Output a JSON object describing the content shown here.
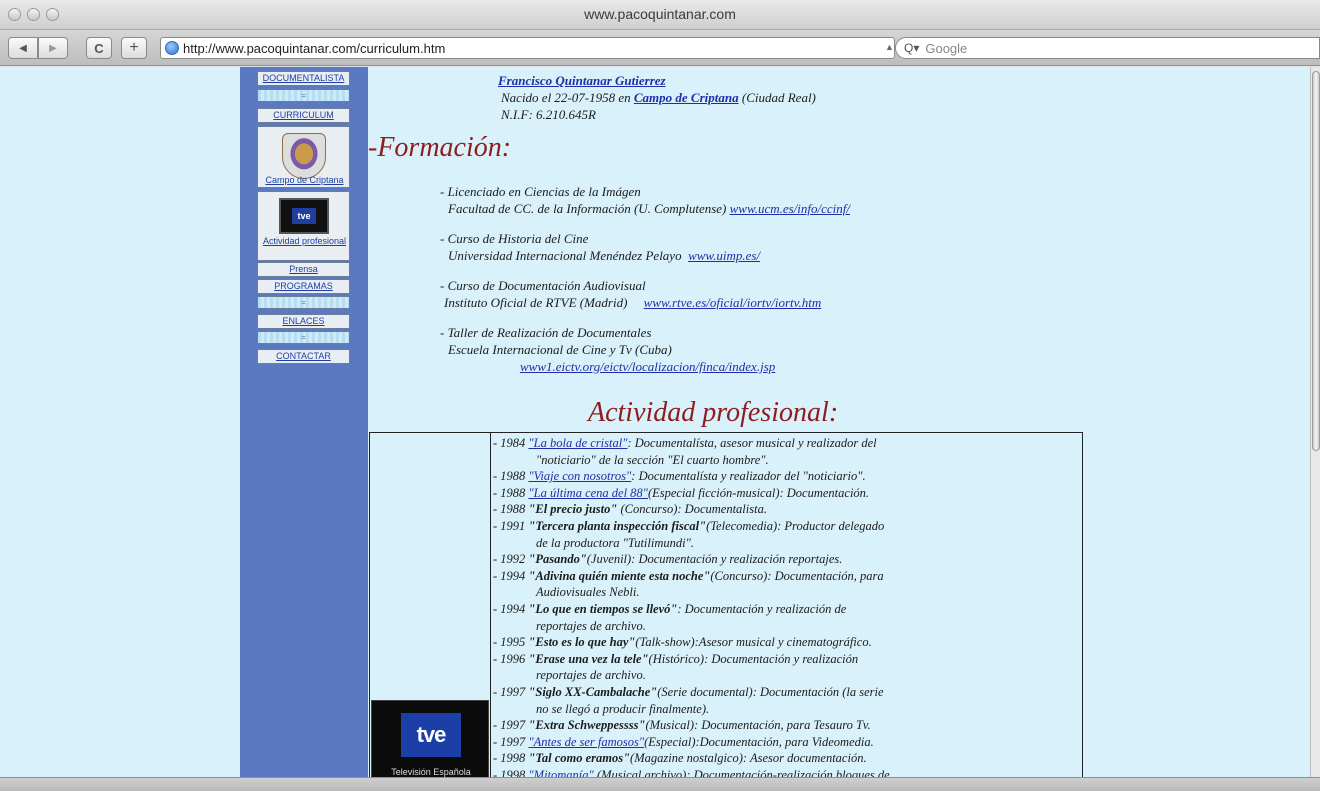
{
  "window": {
    "title": "www.pacoquintanar.com"
  },
  "toolbar": {
    "back": "◀",
    "forward": "▶",
    "reload": "C",
    "add": "+",
    "url": "http://www.pacoquintanar.com/curriculum.htm",
    "search_placeholder": "Google"
  },
  "nav": {
    "documentalista": "DOCUMENTALISTA",
    "sep": "=",
    "curriculum": "CURRICULUM",
    "campo": "Campo de Criptana",
    "tve_small": "tve",
    "actividad": "Actividad profesional",
    "prensa": "Prensa",
    "programas": "PROGRAMAS",
    "enlaces": "ENLACES",
    "contactar": "CONTACTAR"
  },
  "header": {
    "name": "Francisco Quintanar Gutierrez",
    "born_prefix": "Nacido el 22-07-1958 en ",
    "born_place": "Campo de Criptana",
    "born_suffix": " (Ciudad Real)",
    "nif": "N.I.F: 6.210.645R"
  },
  "formacion": {
    "heading": "-Formación:",
    "items": [
      {
        "line1": "- Licenciado en Ciencias de la Imágen",
        "line2": "Facultad de CC. de la Información (U. Complutense) ",
        "link": "www.ucm.es/info/ccinf/"
      },
      {
        "line1": "- Curso de Historia del Cine",
        "line2": "Universidad Internacional Menéndez Pelayo ",
        "link": "www.uimp.es/"
      },
      {
        "line1": "- Curso de Documentación Audiovisual",
        "line2": "Instituto Oficial de RTVE (Madrid) ",
        "link": "www.rtve.es/oficial/iortv/iortv.htm"
      },
      {
        "line1": "- Taller de Realización de Documentales",
        "line2": "Escuela Internacional de Cine y Tv (Cuba)",
        "link": "www1.eictv.org/eictv/localizacion/finca/index.jsp"
      }
    ]
  },
  "actividad": {
    "heading": "Actividad profesional:",
    "tve_logo": "tve",
    "tve_caption": "Televisión Española",
    "entries": [
      {
        "pre": "- 1984 ",
        "title": "\"La bola de cristal\"",
        "linked": true,
        "desc": ": Documentalísta, asesor musical y realizador del",
        "cont": "\"noticiario\" de la sección \"El cuarto hombre\"."
      },
      {
        "pre": "- 1988 ",
        "title": "\"Viaje con nosotros\"",
        "linked": true,
        "desc": ": Documentalísta y realizador del \"noticiario\".",
        "cont": ""
      },
      {
        "pre": "- 1988 ",
        "title": "\"La última cena del 88\"",
        "linked": true,
        "desc": "(Especial ficción-musical): Documentación.",
        "cont": ""
      },
      {
        "pre": "- 1988 ",
        "title": "\"El precio justo\"",
        "linked": false,
        "desc": " (Concurso): Documentalista.",
        "cont": ""
      },
      {
        "pre": "- 1991 ",
        "title": "\"Tercera planta inspección fiscal\"",
        "linked": false,
        "desc": "(Telecomedia): Productor delegado",
        "cont": "de la productora \"Tutilimundi\"."
      },
      {
        "pre": "- 1992 ",
        "title": "\"Pasando\"",
        "linked": false,
        "desc": "(Juvenil): Documentación y realización reportajes.",
        "cont": ""
      },
      {
        "pre": "- 1994 ",
        "title": "\"Adivina quién miente esta noche\"",
        "linked": false,
        "desc": "(Concurso): Documentación, para",
        "cont": "Audiovisuales Nebli."
      },
      {
        "pre": "- 1994 ",
        "title": "\"Lo que en tiempos se llevó\"",
        "linked": false,
        "desc": ": Documentación y realización de",
        "cont": "reportajes de archivo."
      },
      {
        "pre": "- 1995 ",
        "title": "\"Esto es lo que hay\"",
        "linked": false,
        "desc": "(Talk-show):Asesor musical y cinematográfico.",
        "cont": ""
      },
      {
        "pre": "- 1996 ",
        "title": "\"Erase una vez la tele\"",
        "linked": false,
        "desc": "(Histórico): Documentación y realización",
        "cont": "reportajes de archivo."
      },
      {
        "pre": "- 1997 ",
        "title": "\"Siglo XX-Cambalache\"",
        "linked": false,
        "desc": "(Serie documental): Documentación (la serie",
        "cont": "no se llegó a producir finalmente)."
      },
      {
        "pre": "- 1997 ",
        "title": "\"Extra Schweppessss\"",
        "linked": false,
        "desc": "(Musical): Documentación, para Tesauro Tv.",
        "cont": ""
      },
      {
        "pre": "- 1997 ",
        "title": "\"Antes de ser famosos\"",
        "linked": true,
        "desc": "(Especial):Documentación, para Videomedia.",
        "cont": ""
      },
      {
        "pre": "- 1998 ",
        "title": "\"Tal como eramos\"",
        "linked": false,
        "desc": "(Magazine nostalgico): Asesor documentación.",
        "cont": ""
      },
      {
        "pre": "- 1998 ",
        "title": "\"Mitomanía\"",
        "linked": true,
        "desc": " (Musical archivo): Documentación-realización bloques de",
        "cont": ""
      }
    ]
  }
}
